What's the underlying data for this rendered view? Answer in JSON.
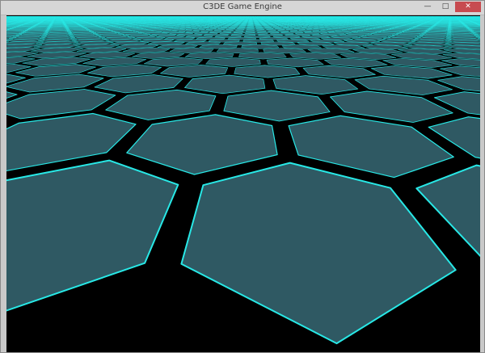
{
  "window": {
    "title": "C3DE Game Engine",
    "controls": {
      "minimize_icon": "minimize-icon",
      "maximize_icon": "maximize-icon",
      "close_icon": "close-icon"
    }
  },
  "scene": {
    "description_colors": {
      "sky": "#000000",
      "tile_fill": "#2f5963",
      "tile_edge_glow": "#28e8e6",
      "gap": "#000000"
    }
  }
}
